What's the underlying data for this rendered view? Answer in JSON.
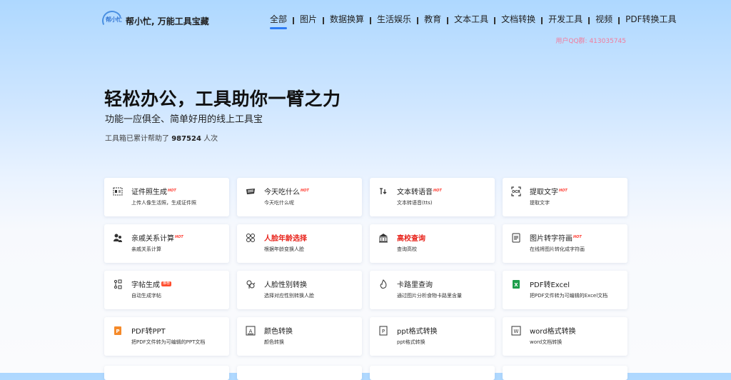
{
  "header": {
    "logo_text": "帮小忙",
    "site_name": "帮小忙, 万能工具宝藏",
    "nav": [
      "全部",
      "图片",
      "数据换算",
      "生活娱乐",
      "教育",
      "文本工具",
      "文档转换",
      "开发工具",
      "视频",
      "PDF转换工具"
    ],
    "active_nav": "全部",
    "qq_group": "用户QQ群: 413035745"
  },
  "hero": {
    "title": "轻松办公，工具助你一臂之力",
    "subtitle": "功能一应俱全、简单好用的线上工具宝",
    "count_prefix": "工具箱已累计帮助了",
    "count_value": "987524",
    "count_suffix": "人次"
  },
  "cards": [
    {
      "title": "证件照生成",
      "desc": "上传人像生活照，生成证件照",
      "badge": "HOT",
      "icon": "id-photo-icon"
    },
    {
      "title": "今天吃什么",
      "desc": "今天吃什么呢",
      "badge": "HOT",
      "icon": "food-icon"
    },
    {
      "title": "文本转语音",
      "desc": "文本转语音(tts)",
      "badge": "HOT",
      "icon": "text-to-speech-icon"
    },
    {
      "title": "提取文字",
      "desc": "提取文字",
      "badge": "HOT",
      "icon": "ocr-icon"
    },
    {
      "title": "亲戚关系计算",
      "desc": "亲戚关系计算",
      "badge": "HOT",
      "icon": "relatives-icon"
    },
    {
      "title": "人脸年龄选择",
      "desc": "根据年龄变换人脸",
      "badge": "",
      "icon": "face-age-icon",
      "red": true
    },
    {
      "title": "高校查询",
      "desc": "查询高校",
      "badge": "",
      "icon": "university-icon",
      "red": true
    },
    {
      "title": "图片转字符画",
      "desc": "在线将图片转化成字符画",
      "badge": "HOT",
      "icon": "image-to-ascii-icon"
    },
    {
      "title": "字帖生成",
      "desc": "自动生成字帖",
      "badge": "推荐",
      "icon": "copybook-icon"
    },
    {
      "title": "人脸性别转换",
      "desc": "选择对应性别转换人脸",
      "badge": "",
      "icon": "gender-swap-icon"
    },
    {
      "title": "卡路里查询",
      "desc": "通过图片分析食物卡路里含量",
      "badge": "",
      "icon": "calorie-icon"
    },
    {
      "title": "PDF转Excel",
      "desc": "把PDF文件转为可编辑的Excel文档",
      "badge": "",
      "icon": "excel-icon"
    },
    {
      "title": "PDF转PPT",
      "desc": "把PDF文件转为可编辑的PPT文档",
      "badge": "",
      "icon": "ppt-icon"
    },
    {
      "title": "颜色转换",
      "desc": "颜色转换",
      "badge": "",
      "icon": "color-icon"
    },
    {
      "title": "ppt格式转换",
      "desc": "ppt格式转换",
      "badge": "",
      "icon": "ppt-format-icon"
    },
    {
      "title": "word格式转换",
      "desc": "word文档转换",
      "badge": "",
      "icon": "word-icon"
    }
  ],
  "colors": {
    "accent": "#2d7bf4",
    "hot": "#ff3b30",
    "qq": "#f27b9b",
    "red_title": "#e8231b"
  }
}
